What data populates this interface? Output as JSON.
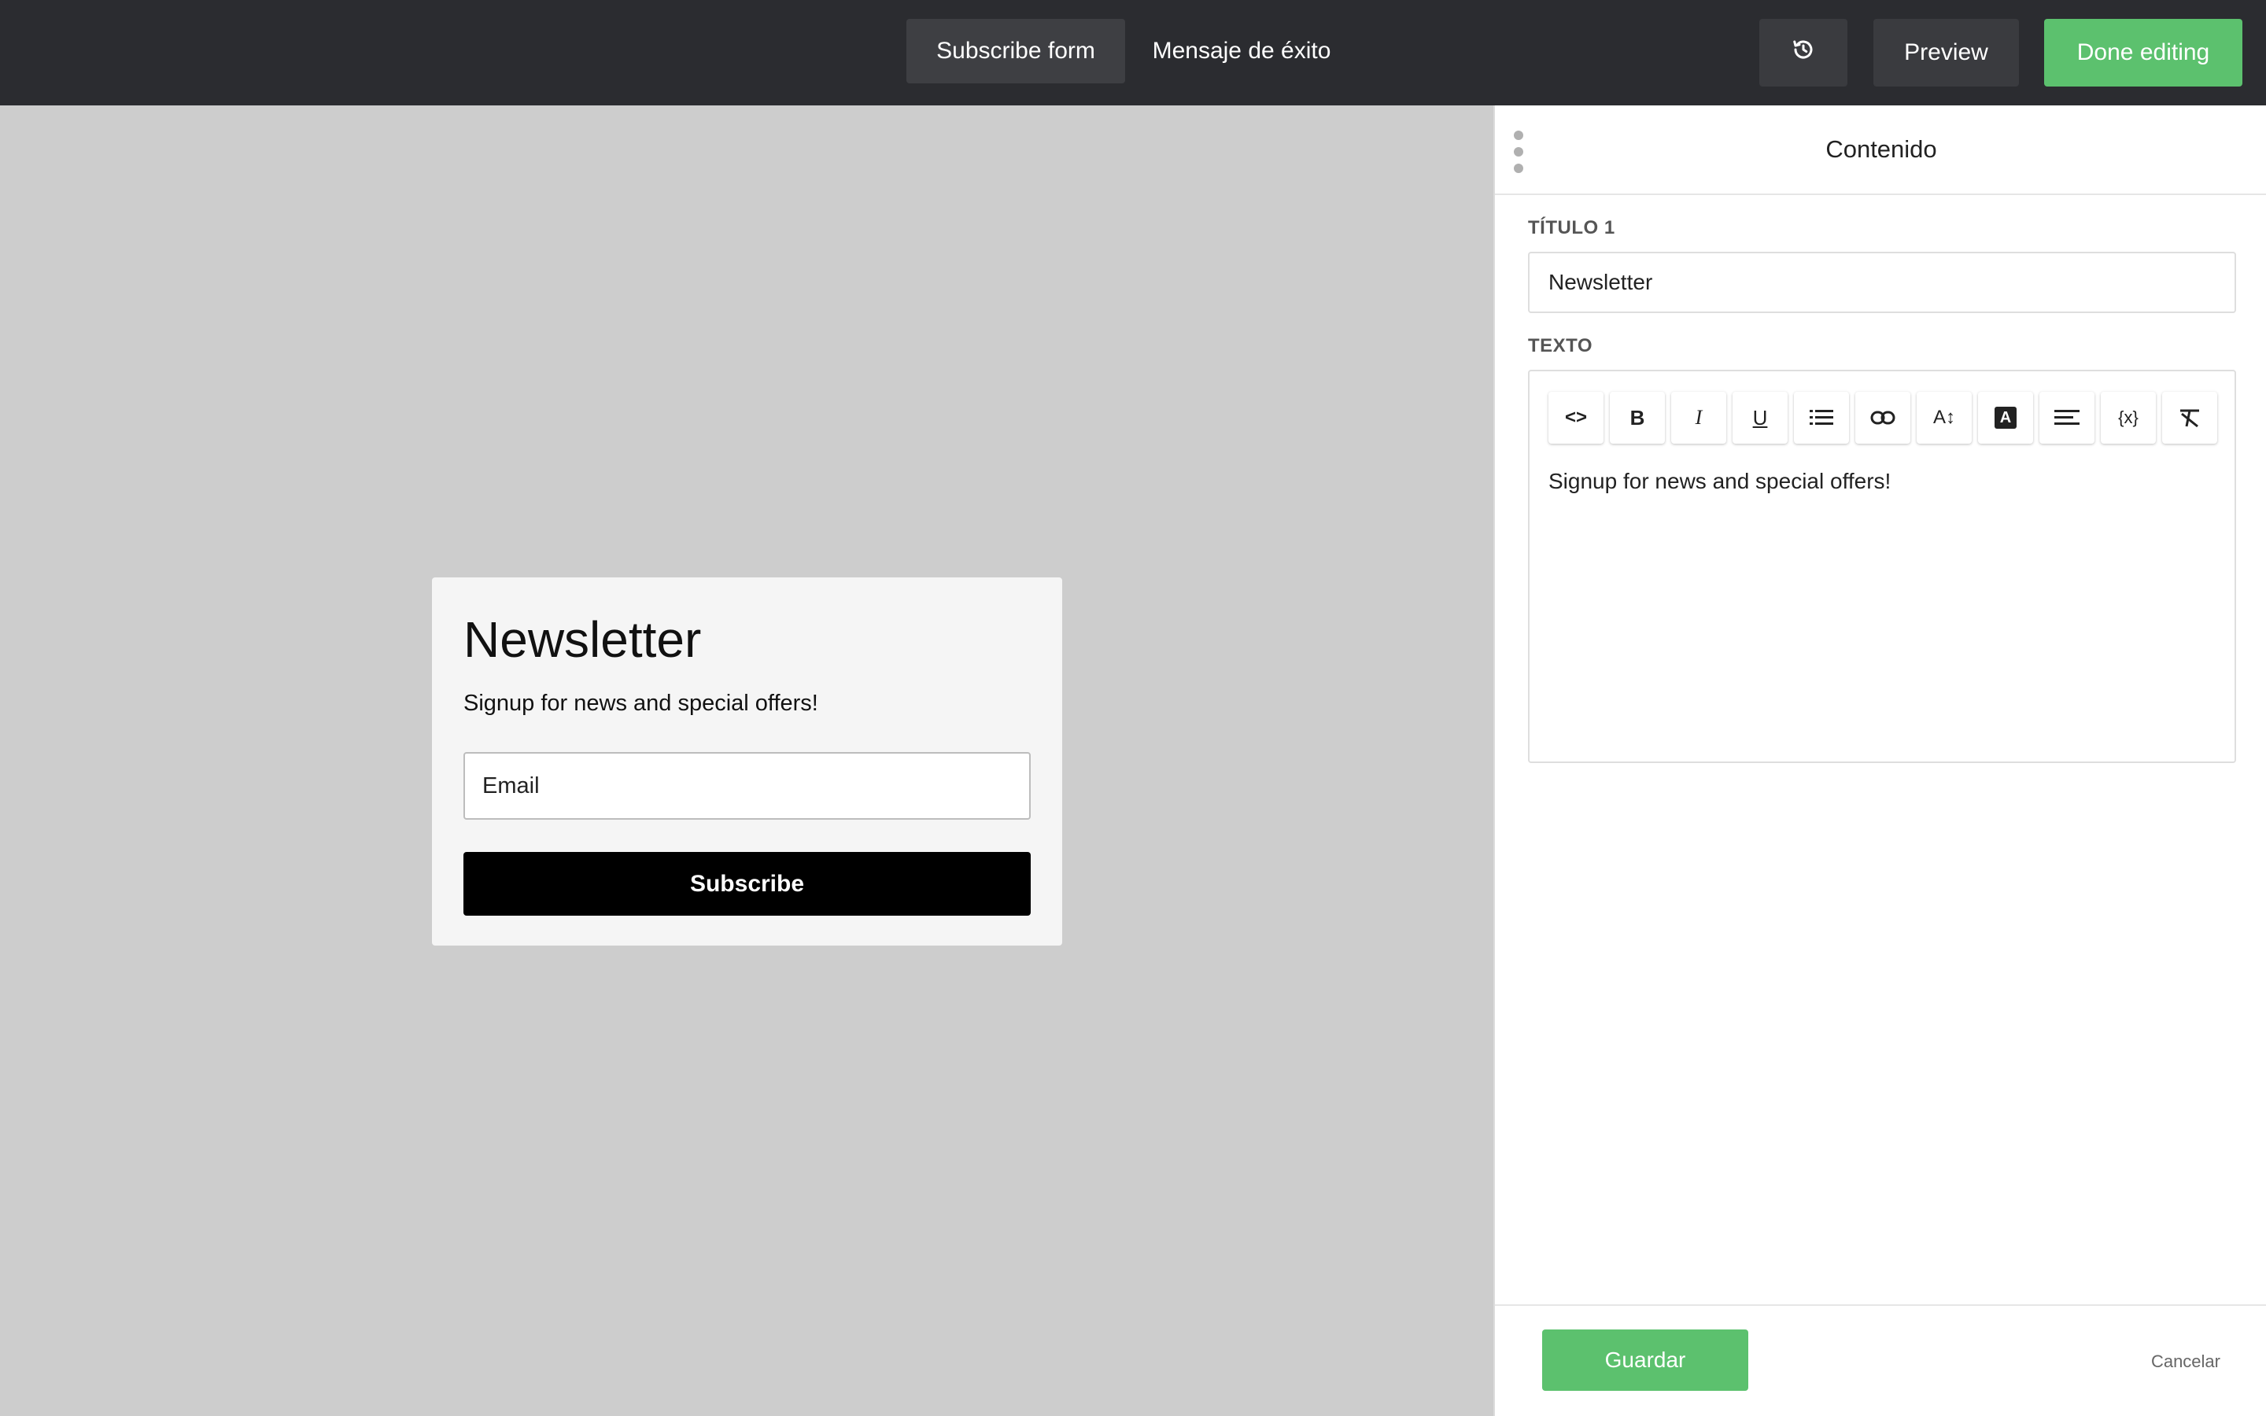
{
  "topbar": {
    "tabs": [
      {
        "label": "Subscribe form",
        "active": true
      },
      {
        "label": "Mensaje de éxito",
        "active": false
      }
    ],
    "history_icon": "history-icon",
    "preview_label": "Preview",
    "done_label": "Done editing",
    "accent_color": "#5cc16e"
  },
  "form": {
    "title": "Newsletter",
    "subtitle": "Signup for news and special offers!",
    "email_placeholder": "Email",
    "subscribe_label": "Subscribe"
  },
  "panel": {
    "title": "Contenido",
    "titulo_label": "TÍTULO 1",
    "titulo_value": "Newsletter",
    "texto_label": "TEXTO",
    "toolbar": [
      {
        "name": "code-icon",
        "glyph": "<>"
      },
      {
        "name": "bold-icon",
        "glyph": "B"
      },
      {
        "name": "italic-icon",
        "glyph": "I"
      },
      {
        "name": "underline-icon",
        "glyph": "U"
      },
      {
        "name": "list-icon",
        "glyph": ""
      },
      {
        "name": "link-icon",
        "glyph": ""
      },
      {
        "name": "font-size-icon",
        "glyph": "A↕"
      },
      {
        "name": "text-color-icon",
        "glyph": "A"
      },
      {
        "name": "align-left-icon",
        "glyph": ""
      },
      {
        "name": "variable-icon",
        "glyph": "{x}"
      },
      {
        "name": "clear-format-icon",
        "glyph": ""
      }
    ],
    "texto_value": "Signup for news and special offers!",
    "save_label": "Guardar",
    "cancel_label": "Cancelar"
  }
}
